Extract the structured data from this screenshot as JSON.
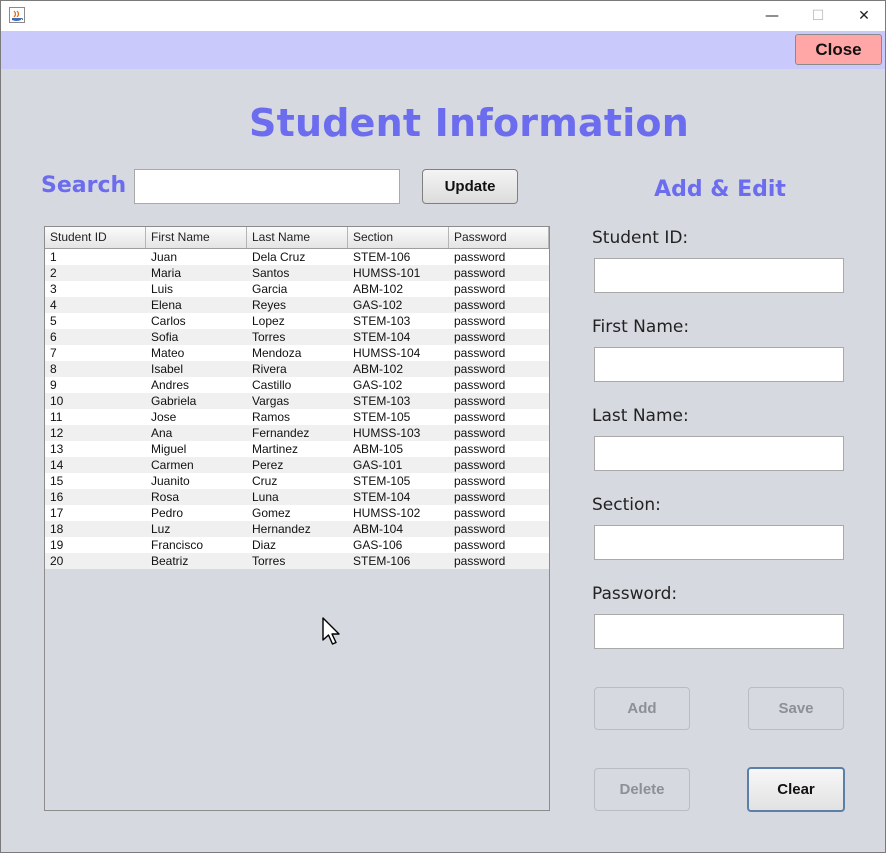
{
  "window": {
    "controls": {
      "minimize": "—",
      "maximize": "☐",
      "close": "✕"
    }
  },
  "topbar": {
    "close_label": "Close"
  },
  "page_title": "Student Information",
  "search": {
    "label": "Search",
    "value": "",
    "update_label": "Update"
  },
  "table": {
    "columns": [
      "Student ID",
      "First Name",
      "Last Name",
      "Section",
      "Password"
    ],
    "rows": [
      [
        "1",
        "Juan",
        "Dela Cruz",
        "STEM-106",
        "password"
      ],
      [
        "2",
        "Maria",
        "Santos",
        "HUMSS-101",
        "password"
      ],
      [
        "3",
        "Luis",
        "Garcia",
        "ABM-102",
        "password"
      ],
      [
        "4",
        "Elena",
        "Reyes",
        "GAS-102",
        "password"
      ],
      [
        "5",
        "Carlos",
        "Lopez",
        "STEM-103",
        "password"
      ],
      [
        "6",
        "Sofia",
        "Torres",
        "STEM-104",
        "password"
      ],
      [
        "7",
        "Mateo",
        "Mendoza",
        "HUMSS-104",
        "password"
      ],
      [
        "8",
        "Isabel",
        "Rivera",
        "ABM-102",
        "password"
      ],
      [
        "9",
        "Andres",
        "Castillo",
        "GAS-102",
        "password"
      ],
      [
        "10",
        "Gabriela",
        "Vargas",
        "STEM-103",
        "password"
      ],
      [
        "11",
        "Jose",
        "Ramos",
        "STEM-105",
        "password"
      ],
      [
        "12",
        "Ana",
        "Fernandez",
        "HUMSS-103",
        "password"
      ],
      [
        "13",
        "Miguel",
        "Martinez",
        "ABM-105",
        "password"
      ],
      [
        "14",
        "Carmen",
        "Perez",
        "GAS-101",
        "password"
      ],
      [
        "15",
        "Juanito",
        "Cruz",
        "STEM-105",
        "password"
      ],
      [
        "16",
        "Rosa",
        "Luna",
        "STEM-104",
        "password"
      ],
      [
        "17",
        "Pedro",
        "Gomez",
        "HUMSS-102",
        "password"
      ],
      [
        "18",
        "Luz",
        "Hernandez",
        "ABM-104",
        "password"
      ],
      [
        "19",
        "Francisco",
        "Diaz",
        "GAS-106",
        "password"
      ],
      [
        "20",
        "Beatriz",
        "Torres",
        "STEM-106",
        "password"
      ]
    ]
  },
  "form": {
    "title": "Add & Edit",
    "student_id_label": "Student ID:",
    "first_name_label": "First Name:",
    "last_name_label": "Last Name:",
    "section_label": "Section:",
    "password_label": "Password:",
    "add_label": "Add",
    "save_label": "Save",
    "delete_label": "Delete",
    "clear_label": "Clear"
  },
  "colors": {
    "accent_text": "#6c6cef",
    "topbar_bg": "#c9c9fb",
    "close_button_bg": "#ffa6a6",
    "window_bg": "#d6d9e0"
  },
  "icons": [
    "java-app-icon",
    "mouse-cursor-icon"
  ]
}
